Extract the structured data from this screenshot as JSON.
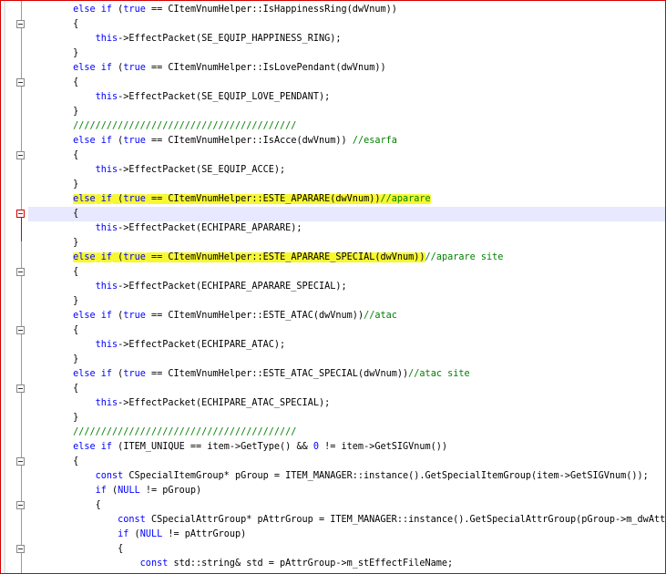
{
  "editor": {
    "lines": [
      {
        "segments": [
          {
            "t": "        "
          },
          {
            "t": "else",
            "c": "kw"
          },
          {
            "t": " "
          },
          {
            "t": "if",
            "c": "kw"
          },
          {
            "t": " ("
          },
          {
            "t": "true",
            "c": "kw"
          },
          {
            "t": " == CItemVnumHelper::IsHappinessRing(dwVnum))"
          }
        ]
      },
      {
        "segments": [
          {
            "t": "        {"
          }
        ]
      },
      {
        "segments": [
          {
            "t": "            "
          },
          {
            "t": "this",
            "c": "kw"
          },
          {
            "t": "->EffectPacket(SE_EQUIP_HAPPINESS_RING);"
          }
        ]
      },
      {
        "segments": [
          {
            "t": "        }"
          }
        ]
      },
      {
        "segments": [
          {
            "t": "        "
          },
          {
            "t": "else",
            "c": "kw"
          },
          {
            "t": " "
          },
          {
            "t": "if",
            "c": "kw"
          },
          {
            "t": " ("
          },
          {
            "t": "true",
            "c": "kw"
          },
          {
            "t": " == CItemVnumHelper::IsLovePendant(dwVnum))"
          }
        ]
      },
      {
        "segments": [
          {
            "t": "        {"
          }
        ]
      },
      {
        "segments": [
          {
            "t": "            "
          },
          {
            "t": "this",
            "c": "kw"
          },
          {
            "t": "->EffectPacket(SE_EQUIP_LOVE_PENDANT);"
          }
        ]
      },
      {
        "segments": [
          {
            "t": "        }"
          }
        ]
      },
      {
        "segments": [
          {
            "t": "        "
          },
          {
            "t": "////////////////////////////////////////",
            "c": "cm"
          }
        ]
      },
      {
        "segments": [
          {
            "t": "        "
          },
          {
            "t": "else",
            "c": "kw"
          },
          {
            "t": " "
          },
          {
            "t": "if",
            "c": "kw"
          },
          {
            "t": " ("
          },
          {
            "t": "true",
            "c": "kw"
          },
          {
            "t": " == CItemVnumHelper::IsAcce(dwVnum)) "
          },
          {
            "t": "//esarfa",
            "c": "cm"
          }
        ]
      },
      {
        "segments": [
          {
            "t": "        {"
          }
        ]
      },
      {
        "segments": [
          {
            "t": "            "
          },
          {
            "t": "this",
            "c": "kw"
          },
          {
            "t": "->EffectPacket(SE_EQUIP_ACCE);"
          }
        ]
      },
      {
        "segments": [
          {
            "t": "        }"
          }
        ]
      },
      {
        "highlight": true,
        "segments": [
          {
            "t": "        "
          },
          {
            "t": "else",
            "c": "kw",
            "h": true
          },
          {
            "t": " ",
            "h": true
          },
          {
            "t": "if",
            "c": "kw",
            "h": true
          },
          {
            "t": " (",
            "h": true
          },
          {
            "t": "true",
            "c": "kw",
            "h": true
          },
          {
            "t": " == CItemVnumHelper::ESTE_APARARE(dwVnum))",
            "h": true
          },
          {
            "t": "//aparare",
            "c": "cm",
            "h": true
          }
        ]
      },
      {
        "current": true,
        "segments": [
          {
            "t": "        {"
          }
        ]
      },
      {
        "segments": [
          {
            "t": "            "
          },
          {
            "t": "this",
            "c": "kw"
          },
          {
            "t": "->EffectPacket(ECHIPARE_APARARE);"
          }
        ]
      },
      {
        "segments": [
          {
            "t": "        }"
          }
        ]
      },
      {
        "highlight": true,
        "segments": [
          {
            "t": "        "
          },
          {
            "t": "else",
            "c": "kw",
            "h": true
          },
          {
            "t": " ",
            "h": true
          },
          {
            "t": "if",
            "c": "kw",
            "h": true
          },
          {
            "t": " (",
            "h": true
          },
          {
            "t": "true",
            "c": "kw",
            "h": true
          },
          {
            "t": " == CItemVnumHelper::ESTE_APARARE_SPECIAL(dwVnum))",
            "h": true
          },
          {
            "t": "//aparare site",
            "c": "cm"
          }
        ]
      },
      {
        "segments": [
          {
            "t": "        {"
          }
        ]
      },
      {
        "segments": [
          {
            "t": "            "
          },
          {
            "t": "this",
            "c": "kw"
          },
          {
            "t": "->EffectPacket(ECHIPARE_APARARE_SPECIAL);"
          }
        ]
      },
      {
        "segments": [
          {
            "t": "        }"
          }
        ]
      },
      {
        "segments": [
          {
            "t": "        "
          },
          {
            "t": "else",
            "c": "kw"
          },
          {
            "t": " "
          },
          {
            "t": "if",
            "c": "kw"
          },
          {
            "t": " ("
          },
          {
            "t": "true",
            "c": "kw"
          },
          {
            "t": " == CItemVnumHelper::ESTE_ATAC(dwVnum))"
          },
          {
            "t": "//atac",
            "c": "cm"
          }
        ]
      },
      {
        "segments": [
          {
            "t": "        {"
          }
        ]
      },
      {
        "segments": [
          {
            "t": "            "
          },
          {
            "t": "this",
            "c": "kw"
          },
          {
            "t": "->EffectPacket(ECHIPARE_ATAC);"
          }
        ]
      },
      {
        "segments": [
          {
            "t": "        }"
          }
        ]
      },
      {
        "segments": [
          {
            "t": "        "
          },
          {
            "t": "else",
            "c": "kw"
          },
          {
            "t": " "
          },
          {
            "t": "if",
            "c": "kw"
          },
          {
            "t": " ("
          },
          {
            "t": "true",
            "c": "kw"
          },
          {
            "t": " == CItemVnumHelper::ESTE_ATAC_SPECIAL(dwVnum))"
          },
          {
            "t": "//atac site",
            "c": "cm"
          }
        ]
      },
      {
        "segments": [
          {
            "t": "        {"
          }
        ]
      },
      {
        "segments": [
          {
            "t": "            "
          },
          {
            "t": "this",
            "c": "kw"
          },
          {
            "t": "->EffectPacket(ECHIPARE_ATAC_SPECIAL);"
          }
        ]
      },
      {
        "segments": [
          {
            "t": "        }"
          }
        ]
      },
      {
        "segments": [
          {
            "t": "        "
          },
          {
            "t": "////////////////////////////////////////",
            "c": "cm"
          }
        ]
      },
      {
        "segments": [
          {
            "t": "        "
          },
          {
            "t": "else",
            "c": "kw"
          },
          {
            "t": " "
          },
          {
            "t": "if",
            "c": "kw"
          },
          {
            "t": " (ITEM_UNIQUE == item->GetType() && "
          },
          {
            "t": "0",
            "c": "kw"
          },
          {
            "t": " != item->GetSIGVnum())"
          }
        ]
      },
      {
        "segments": [
          {
            "t": "        {"
          }
        ]
      },
      {
        "segments": [
          {
            "t": "            "
          },
          {
            "t": "const",
            "c": "kw"
          },
          {
            "t": " CSpecialItemGroup* pGroup = ITEM_MANAGER::instance().GetSpecialItemGroup(item->GetSIGVnum());"
          }
        ]
      },
      {
        "segments": [
          {
            "t": "            "
          },
          {
            "t": "if",
            "c": "kw"
          },
          {
            "t": " ("
          },
          {
            "t": "NULL",
            "c": "kw"
          },
          {
            "t": " != pGroup)"
          }
        ]
      },
      {
        "segments": [
          {
            "t": "            {"
          }
        ]
      },
      {
        "segments": [
          {
            "t": "                "
          },
          {
            "t": "const",
            "c": "kw"
          },
          {
            "t": " CSpecialAttrGroup* pAttrGroup = ITEM_MANAGER::instance().GetSpecialAttrGroup(pGroup->m_dwAttrVnum);"
          }
        ]
      },
      {
        "segments": [
          {
            "t": "                "
          },
          {
            "t": "if",
            "c": "kw"
          },
          {
            "t": " ("
          },
          {
            "t": "NULL",
            "c": "kw"
          },
          {
            "t": " != pAttrGroup)"
          }
        ]
      },
      {
        "segments": [
          {
            "t": "                {"
          }
        ]
      },
      {
        "segments": [
          {
            "t": "                    "
          },
          {
            "t": "const",
            "c": "kw"
          },
          {
            "t": " std::string& std = pAttrGroup->m_stEffectFileName;"
          }
        ]
      }
    ],
    "fold_markers": [
      {
        "line": 1
      },
      {
        "line": 5
      },
      {
        "line": 10
      },
      {
        "line": 14,
        "red": true
      },
      {
        "line": 18
      },
      {
        "line": 22
      },
      {
        "line": 26
      },
      {
        "line": 31
      },
      {
        "line": 34
      },
      {
        "line": 37
      }
    ],
    "colors": {
      "keyword": "#0000ff",
      "comment": "#008000",
      "highlight": "#f7f733",
      "current_line": "#e8e8ff",
      "border": "#d40000"
    }
  }
}
